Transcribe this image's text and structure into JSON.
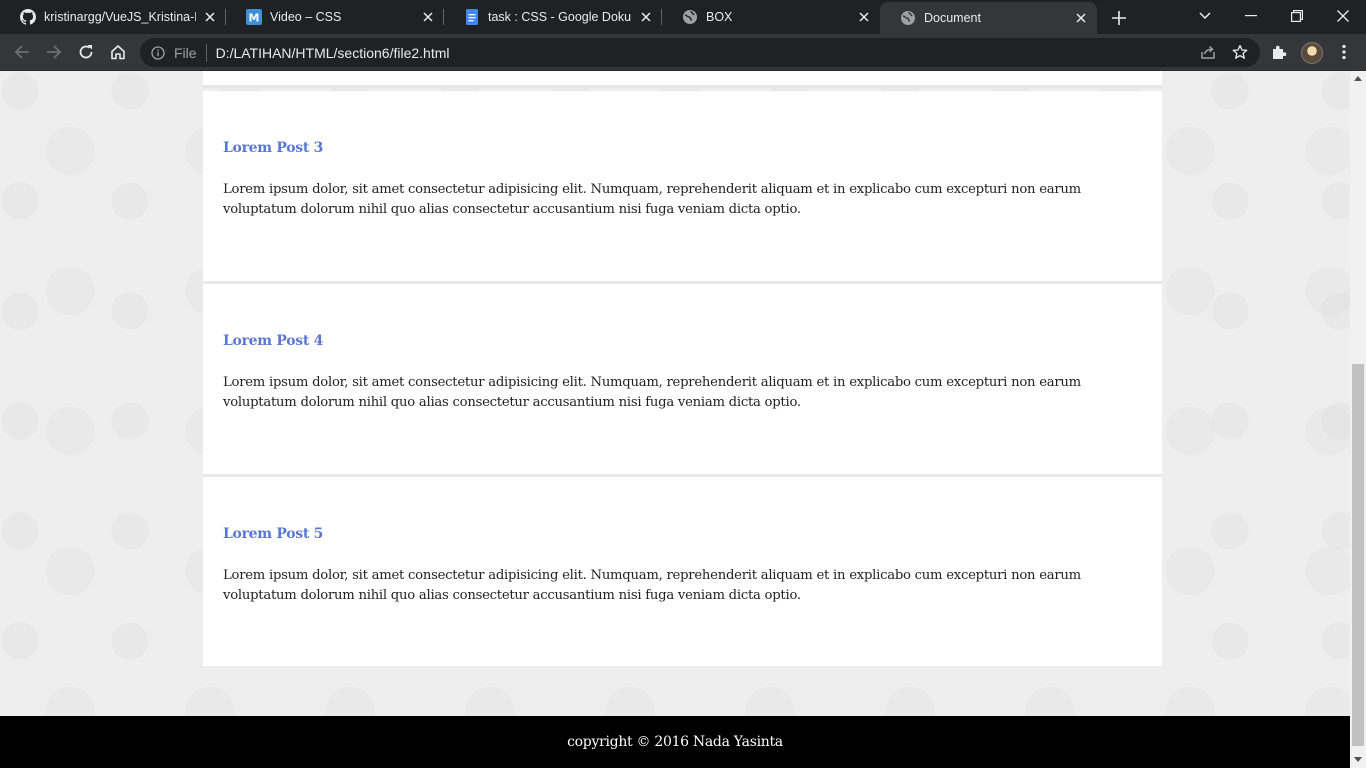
{
  "browser": {
    "tabs": [
      {
        "title": "kristinargg/VueJS_Kristina-Ra",
        "icon": "github-icon",
        "active": false
      },
      {
        "title": "Video – CSS",
        "icon": "moodle-icon",
        "active": false
      },
      {
        "title": "task : CSS - Google Dokumen",
        "icon": "google-docs-icon",
        "active": false
      },
      {
        "title": "BOX",
        "icon": "globe-icon",
        "active": false
      },
      {
        "title": "Document",
        "icon": "globe-icon",
        "active": true
      }
    ],
    "address": {
      "scheme_label": "File",
      "url": "D:/LATIHAN/HTML/section6/file2.html"
    }
  },
  "page": {
    "posts": [
      {
        "title": "Lorem Post 3",
        "body": "Lorem ipsum dolor, sit amet consectetur adipisicing elit. Numquam, reprehenderit aliquam et in explicabo cum excepturi non earum voluptatum dolorum nihil quo alias consectetur accusantium nisi fuga veniam dicta optio."
      },
      {
        "title": "Lorem Post 4",
        "body": "Lorem ipsum dolor, sit amet consectetur adipisicing elit. Numquam, reprehenderit aliquam et in explicabo cum excepturi non earum voluptatum dolorum nihil quo alias consectetur accusantium nisi fuga veniam dicta optio."
      },
      {
        "title": "Lorem Post 5",
        "body": "Lorem ipsum dolor, sit amet consectetur adipisicing elit. Numquam, reprehenderit aliquam et in explicabo cum excepturi non earum voluptatum dolorum nihil quo alias consectetur accusantium nisi fuga veniam dicta optio."
      }
    ],
    "footer": {
      "text": "copyright © 2016 Nada Yasinta"
    }
  },
  "colors": {
    "post_title": "#5b78d0",
    "footer_bg": "#000000",
    "browser_bg": "#202124",
    "toolbar_bg": "#35363a"
  }
}
